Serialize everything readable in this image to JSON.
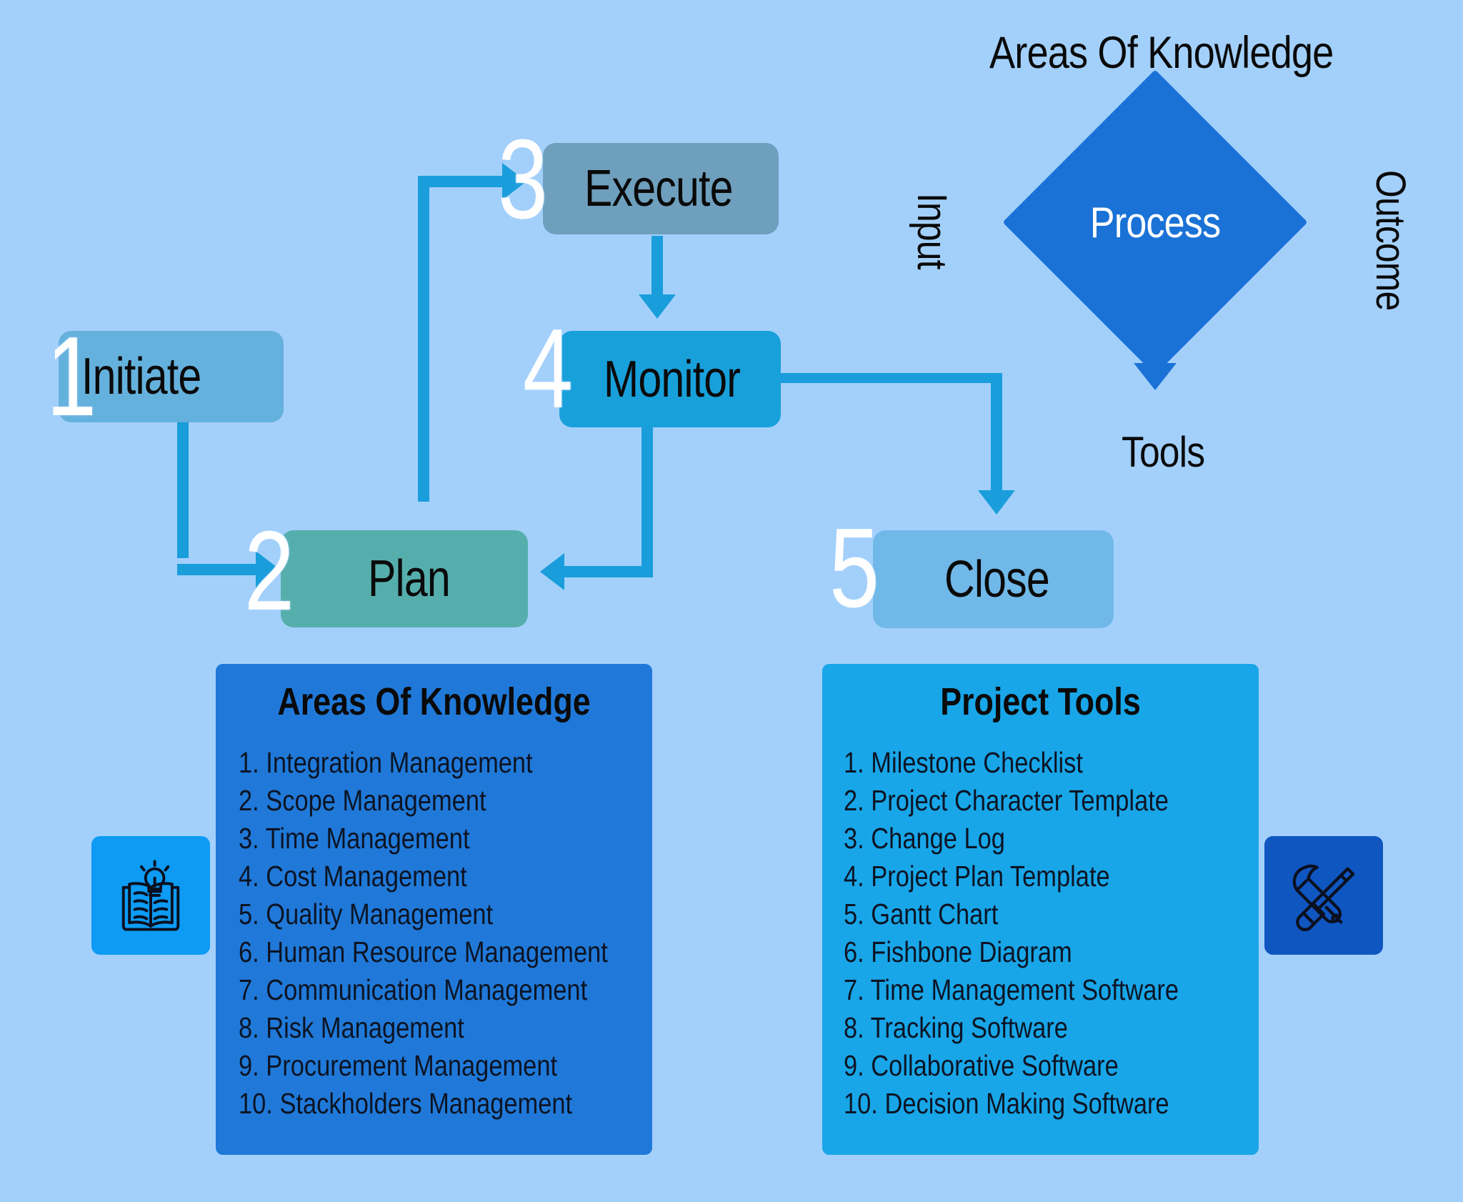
{
  "canvas": {
    "background": "#a3d0fb"
  },
  "flow": {
    "steps": [
      {
        "num": "1",
        "label": "Initiate",
        "color": "#65b1dd"
      },
      {
        "num": "2",
        "label": "Plan",
        "color": "#56aeac"
      },
      {
        "num": "3",
        "label": "Execute",
        "color": "#6e9fbd"
      },
      {
        "num": "4",
        "label": "Monitor",
        "color": "#18a0db"
      },
      {
        "num": "5",
        "label": "Close",
        "color": "#70b8e8"
      }
    ],
    "connector_color": "#1a9ddb"
  },
  "process_diamond": {
    "center_label": "Process",
    "top_label": "Areas Of Knowledge",
    "left_label": "Input",
    "right_label": "Outcome",
    "bottom_label": "Tools",
    "color": "#1a72d6",
    "center_text_color": "#ffffff"
  },
  "panels": [
    {
      "id": "knowledge",
      "title": "Areas Of Knowledge",
      "color": "#2079d8",
      "icon": "book-lightbulb-icon",
      "icon_tile_color": "#0d9bf3",
      "items": [
        "1. Integration Management",
        "2. Scope Management",
        "3. Time Management",
        "4. Cost Management",
        "5. Quality Management",
        "6. Human Resource Management",
        "7. Communication Management",
        "8. Risk Management",
        "9. Procurement Management",
        "10. Stackholders Management"
      ]
    },
    {
      "id": "tools",
      "title": "Project Tools",
      "color": "#18a6e8",
      "icon": "wrench-screwdriver-icon",
      "icon_tile_color": "#0f56c0",
      "items": [
        "1. Milestone Checklist",
        "2. Project Character Template",
        "3. Change Log",
        "4. Project Plan Template",
        "5. Gantt Chart",
        "6. Fishbone Diagram",
        "7. Time Management Software",
        "8. Tracking Software",
        "9. Collaborative Software",
        "10. Decision Making Software"
      ]
    }
  ]
}
